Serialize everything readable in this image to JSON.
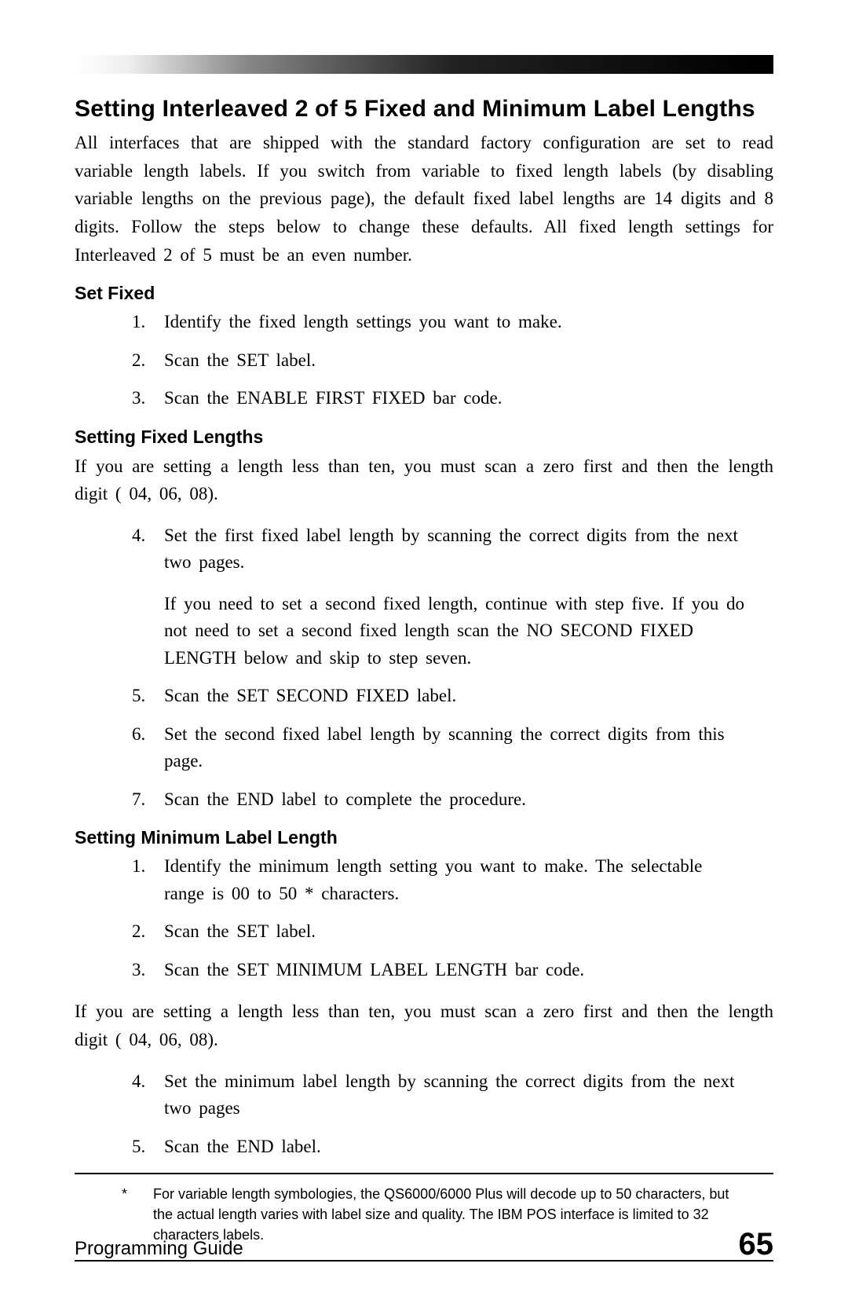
{
  "title": "Setting Interleaved 2 of 5 Fixed and Minimum Label Lengths",
  "intro": "All interfaces that are shipped with the standard factory configuration are set to read variable length labels.  If you switch from variable to fixed length labels (by disabling variable lengths on the previous page), the default fixed label lengths are 14 digits and 8 digits.  Follow the steps below to change these defaults.  All fixed length settings for Interleaved 2 of 5 must be an even number.",
  "section1": {
    "heading": "Set Fixed",
    "items": [
      "Identify the fixed length settings you want to make.",
      "Scan  the  SET  label.",
      "Scan the ENABLE FIRST FIXED bar code."
    ]
  },
  "section2": {
    "heading": "Setting Fixed Lengths",
    "intro": "If you are setting a length less than ten, you must scan a zero first and then the length digit ( 04, 06, 08).",
    "items": [
      {
        "main": "Set the first fixed label length by scanning the correct digits from the next two pages.",
        "sub": "If you need to set a second fixed length, continue with step five.  If you do not need to set a second fixed length scan the NO SECOND FIXED LENGTH below and skip to step seven."
      },
      {
        "main": "Scan the SET SECOND FIXED label."
      },
      {
        "main": "Set the second fixed label length by scanning the correct digits from this page."
      },
      {
        "main": "Scan the END label to complete the procedure."
      }
    ]
  },
  "section3": {
    "heading": "Setting Minimum Label Length",
    "items1": [
      "Identify the minimum length setting you want to make. The selectable range is 00 to 50 * characters.",
      "Scan  the  SET  label.",
      "Scan the SET MINIMUM LABEL LENGTH bar code."
    ],
    "intro2": "If you are setting a length less than ten, you must scan a zero first and then the length digit ( 04, 06, 08).",
    "items2": [
      "Set the minimum label length by scanning the correct digits from the next two pages",
      "Scan  the  END  label."
    ]
  },
  "footnote": {
    "star": "*",
    "text": "For variable length symbologies, the QS6000/6000 Plus will decode up to 50 characters, but the actual length varies with label size and quality.  The IBM POS interface is limited to 32 characters labels."
  },
  "footer": {
    "left": "Programming Guide",
    "page": "65"
  }
}
